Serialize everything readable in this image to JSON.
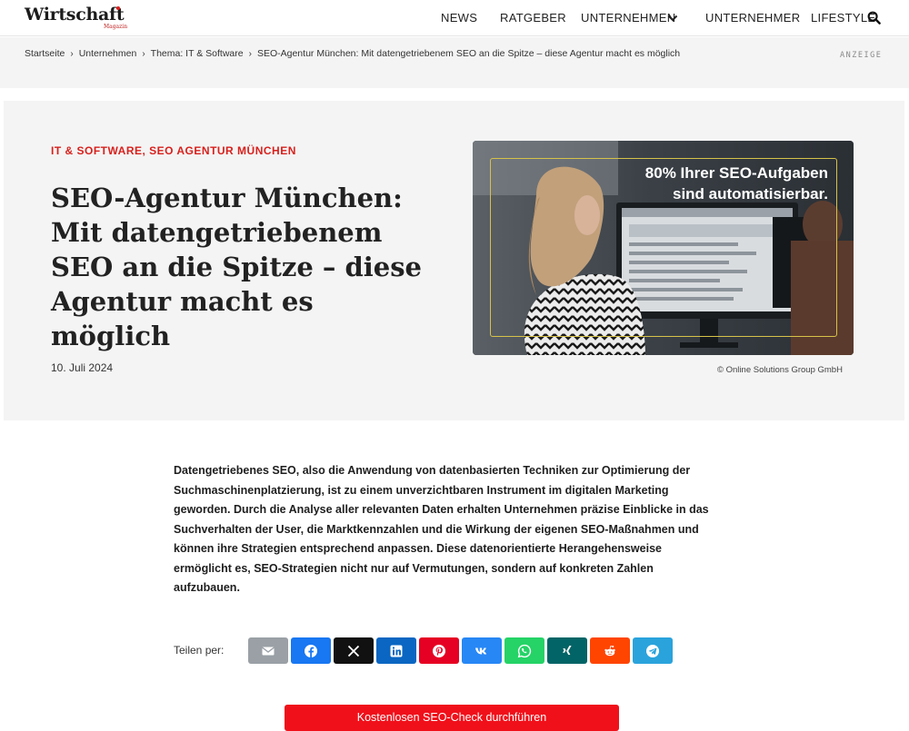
{
  "header": {
    "logo_text": "Wirtschaft",
    "logo_sub": "Magazin",
    "nav": [
      {
        "label": "NEWS"
      },
      {
        "label": "RATGEBER"
      },
      {
        "label": "UNTERNEHMEN"
      },
      {
        "label": "UNTERNEHMER"
      },
      {
        "label": "LIFESTYLE"
      }
    ]
  },
  "breadcrumb": {
    "items": [
      "Startseite",
      "Unternehmen",
      "Thema: IT & Software",
      "SEO-Agentur München: Mit datengetriebenem SEO an die Spitze – diese Agentur macht es möglich"
    ],
    "ad_label": "ANZEIGE"
  },
  "article": {
    "category": "IT & SOFTWARE, SEO AGENTUR MÜNCHEN",
    "title": "SEO-Agentur München: Mit datengetriebenem SEO an die Spitze – diese Agentur macht es möglich",
    "date": "10. Juli 2024",
    "image_headline_1": "80% Ihrer SEO-Aufgaben",
    "image_headline_2": "sind automatisierbar.",
    "image_credit": "© Online Solutions Group GmbH",
    "lead": "Datengetriebenes SEO, also die Anwendung von datenbasierten Techniken zur Optimierung der Suchmaschinenplatzierung, ist zu einem unverzichtbaren Instrument im digitalen Marketing geworden. Durch die Analyse aller relevanten Daten erhalten Unternehmen präzise Einblicke in das Suchverhalten der User, die Marktkennzahlen und die Wirkung der eigenen SEO-Maßnahmen und können ihre Strategien entsprechend anpassen. Diese datenorientierte Herangehensweise ermöglicht es, SEO-Strategien nicht nur auf Vermutungen, sondern auf konkreten Zahlen aufzubauen."
  },
  "share": {
    "label": "Teilen per:",
    "buttons": [
      {
        "name": "email",
        "icon": "mail-icon",
        "color": "#9aa0a6"
      },
      {
        "name": "facebook",
        "icon": "facebook-icon",
        "color": "#1877f2"
      },
      {
        "name": "x",
        "icon": "x-icon",
        "color": "#111111"
      },
      {
        "name": "linkedin",
        "icon": "linkedin-icon",
        "color": "#0a66c2"
      },
      {
        "name": "pinterest",
        "icon": "pinterest-icon",
        "color": "#e60023"
      },
      {
        "name": "vk",
        "icon": "vk-icon",
        "color": "#2787f5"
      },
      {
        "name": "whatsapp",
        "icon": "whatsapp-icon",
        "color": "#25d366"
      },
      {
        "name": "xing",
        "icon": "xing-icon",
        "color": "#026466"
      },
      {
        "name": "reddit",
        "icon": "reddit-icon",
        "color": "#ff4500"
      },
      {
        "name": "telegram",
        "icon": "telegram-icon",
        "color": "#2aa3dc"
      }
    ]
  },
  "cta": {
    "label": "Kostenlosen SEO-Check durchführen",
    "color": "#f0101a"
  },
  "colors": {
    "accent": "#d8201c",
    "hero_bg": "#f4f4f4"
  }
}
